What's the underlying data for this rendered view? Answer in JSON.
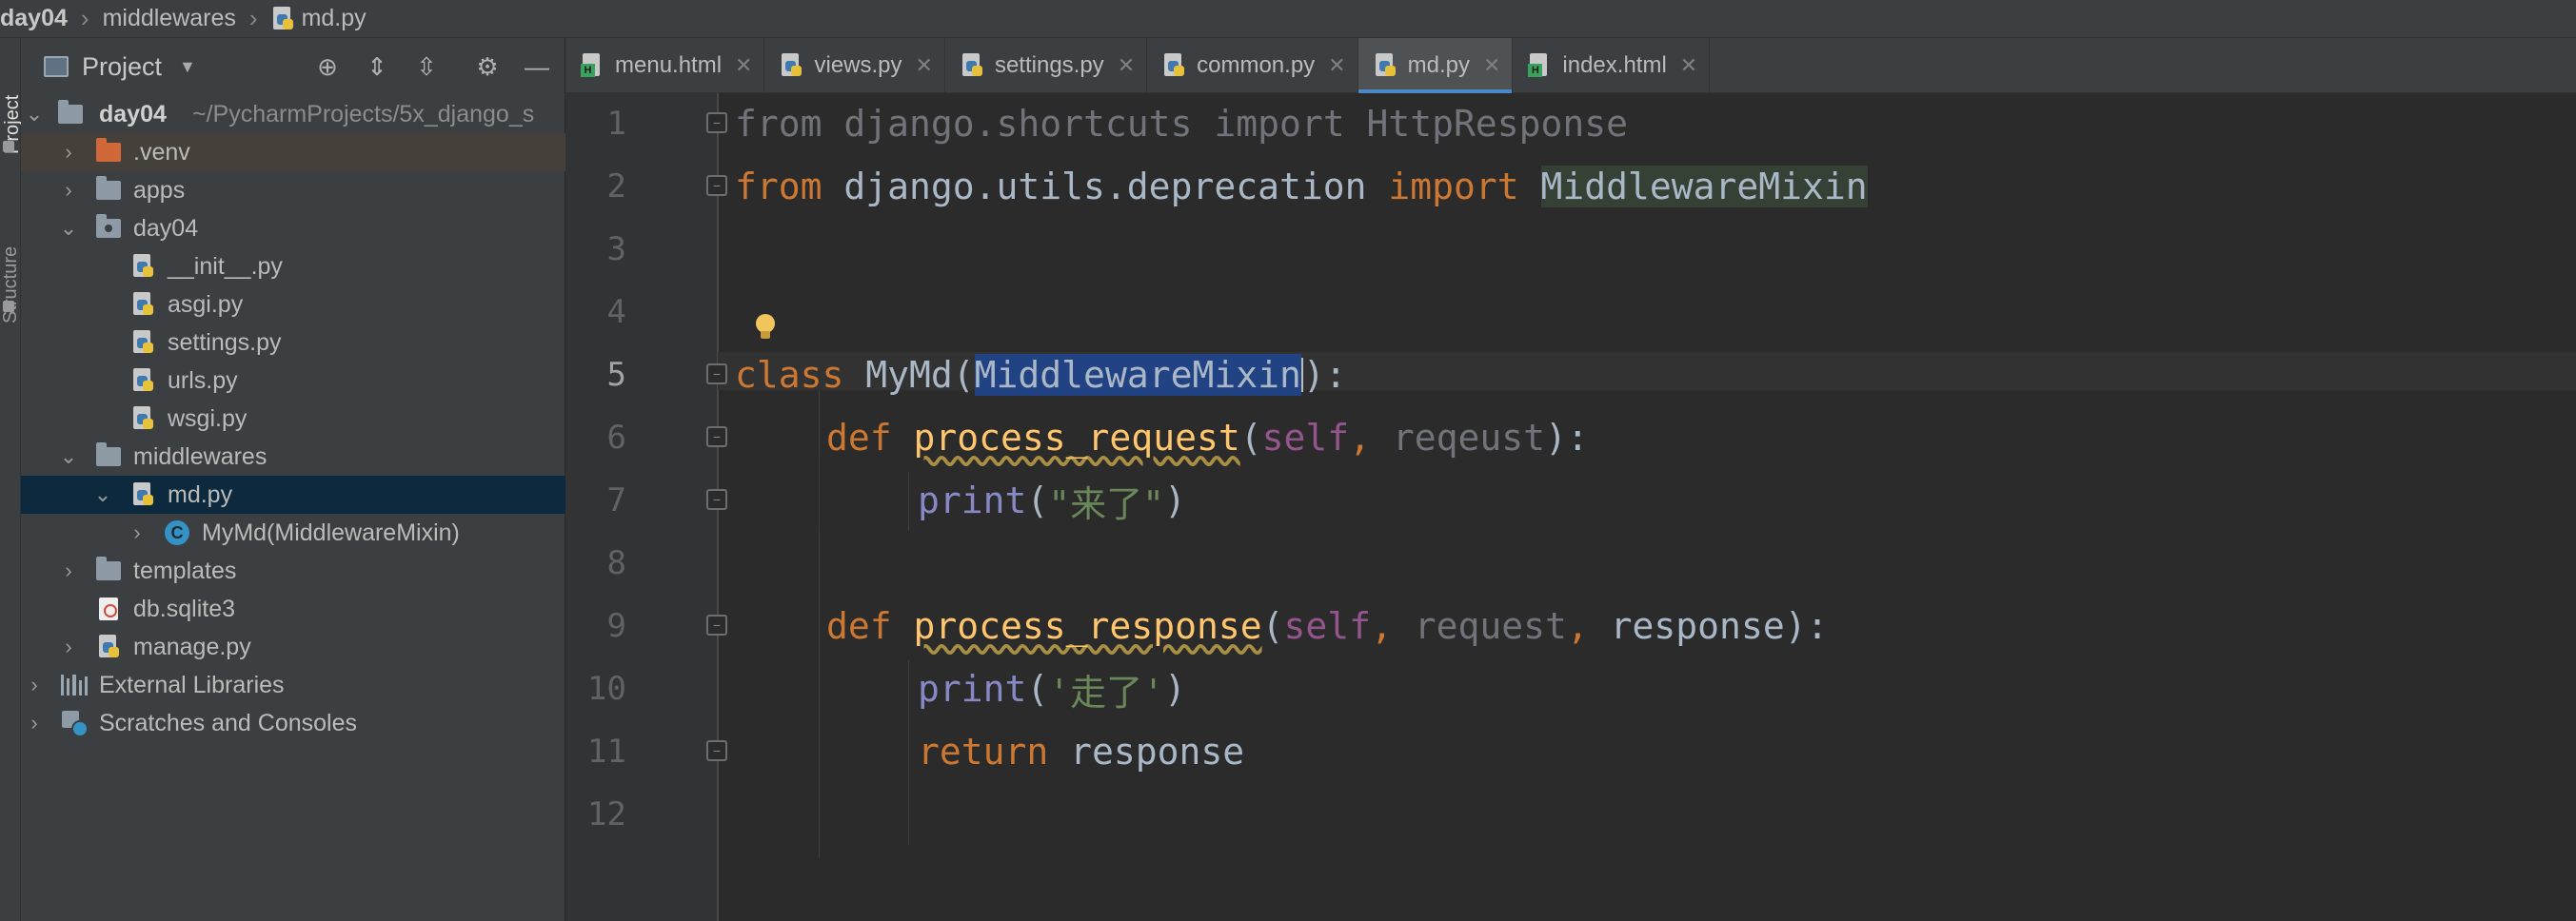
{
  "breadcrumb": [
    "day04",
    "middlewares",
    "md.py"
  ],
  "left_strip": {
    "project_label": "Project",
    "structure_label": "Structure"
  },
  "project_panel": {
    "title": "Project",
    "root_name": "day04",
    "root_path": "~/PycharmProjects/5x_django_s",
    "items": {
      "venv": ".venv",
      "apps": "apps",
      "day04": "day04",
      "init": "__init__.py",
      "asgi": "asgi.py",
      "settings": "settings.py",
      "urls": "urls.py",
      "wsgi": "wsgi.py",
      "middlewares": "middlewares",
      "md": "md.py",
      "mymd": "MyMd(MiddlewareMixin)",
      "templates": "templates",
      "db": "db.sqlite3",
      "manage": "manage.py",
      "external": "External Libraries",
      "scratches": "Scratches and Consoles"
    }
  },
  "tabs": [
    "menu.html",
    "views.py",
    "settings.py",
    "common.py",
    "md.py",
    "index.html"
  ],
  "active_tab": "md.py",
  "code": {
    "line_numbers": [
      "1",
      "2",
      "3",
      "4",
      "5",
      "6",
      "7",
      "8",
      "9",
      "10",
      "11",
      "12"
    ],
    "l1": {
      "a": "from",
      "b": " django.shortcuts ",
      "c": "import",
      "d": " HttpResponse"
    },
    "l2": {
      "a": "from",
      "b": " django.utils.deprecation ",
      "c": "import",
      "d": " ",
      "e": "MiddlewareMixin"
    },
    "l5": {
      "a": "class",
      "b": " MyMd(",
      "c": "MiddlewareMixin",
      "d": "):"
    },
    "l6": {
      "a": "def",
      "b": " ",
      "c": "process_request",
      "d": "(",
      "e": "self",
      "f": ", ",
      "g": "reqeust",
      "h": "):"
    },
    "l7": {
      "a": "print",
      "b": "(",
      "c": "\"来了\"",
      "d": ")"
    },
    "l9": {
      "a": "def",
      "b": " ",
      "c": "process_response",
      "d": "(",
      "e": "self",
      "f": ", ",
      "g": "request",
      "h": ", ",
      "i": "response",
      "j": "):"
    },
    "l10": {
      "a": "print",
      "b": "(",
      "c": "'走了'",
      "d": ")"
    },
    "l11": {
      "a": "return",
      "b": " response"
    }
  },
  "colors": {
    "keyword": "#cc7832",
    "function": "#ffc66d",
    "self": "#94558d",
    "string": "#6a8759",
    "selection": "#214283",
    "tab_underline": "#4a88c7"
  }
}
